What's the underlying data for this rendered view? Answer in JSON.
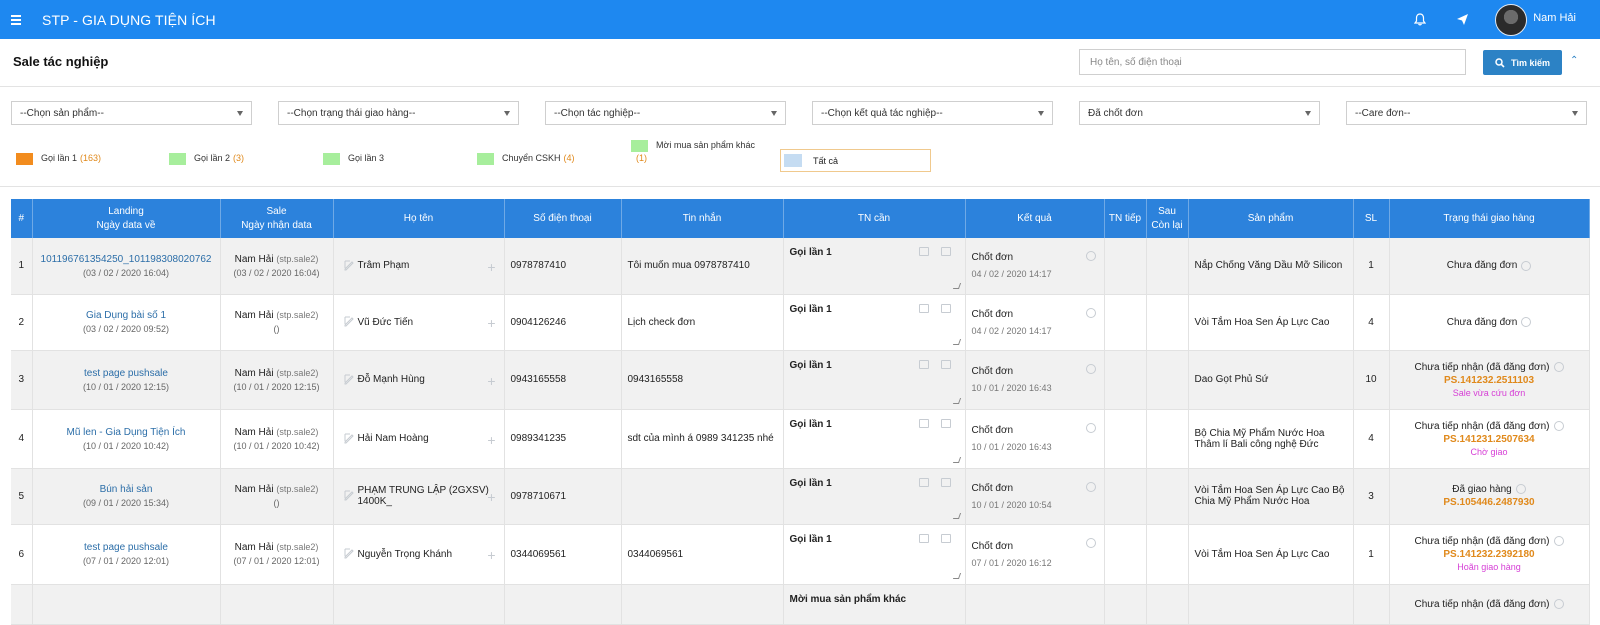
{
  "app": {
    "title": "STP - GIA DỤNG TIỆN ÍCH",
    "user": "Nam Hải"
  },
  "header": {
    "title": "Sale tác nghiệp",
    "search_placeholder": "Họ tên, số điện thoại",
    "search_label": "Tìm kiếm"
  },
  "filters": [
    "--Chọn sản phẩm--",
    "--Chọn trạng thái giao hàng--",
    "--Chọn tác nghiệp--",
    "--Chọn kết quả tác nghiệp--",
    "Đã chốt đơn",
    "--Care đơn--"
  ],
  "legend": [
    {
      "label": "Gọi lần 1",
      "count": "(163)",
      "color": "#f28c1e"
    },
    {
      "label": "Gọi lần 2",
      "count": "(3)",
      "color": "#a7ee9c"
    },
    {
      "label": "Gọi lần 3",
      "count": "",
      "color": "#a7ee9c"
    },
    {
      "label": "Chuyển CSKH",
      "count": "(4)",
      "color": "#a7ee9c"
    },
    {
      "label": "Mời mua sản phẩm khác",
      "count": "(1)",
      "color": "#a7ee9c"
    }
  ],
  "legend_all": {
    "label": "Tất cả",
    "color": "#c5dcf2"
  },
  "table": {
    "headers": {
      "num": "#",
      "landing_1": "Landing",
      "landing_2": "Ngày data về",
      "sale_1": "Sale",
      "sale_2": "Ngày nhận data",
      "name": "Họ tên",
      "phone": "Số điện thoại",
      "message": "Tin nhắn",
      "tncan": "TN cần",
      "result": "Kết quả",
      "tntiep": "TN tiếp",
      "sau_1": "Sau",
      "sau_2": "Còn lại",
      "product": "Sản phẩm",
      "qty": "SL",
      "status": "Trạng thái giao hàng"
    },
    "rows": [
      {
        "num": "1",
        "landing": "101196761354250_101198308020762",
        "landing_date": "(03 / 02 / 2020 16:04)",
        "sale": "Nam Hải",
        "sale_code": "(stp.sale2)",
        "sale_date": "(03 / 02 / 2020 16:04)",
        "name": "Trâm Phạm",
        "phone": "0978787410",
        "message": "Tôi muốn mua 0978787410",
        "tncan": "Gọi lần 1",
        "result": "Chốt đơn",
        "result_date": "04 / 02 / 2020 14:17",
        "product": "Nắp Chống Văng Dầu Mỡ Silicon",
        "qty": "1",
        "status": "Chưa đăng đơn",
        "status_code": "",
        "status_note": ""
      },
      {
        "num": "2",
        "landing": "Gia Dụng bài số 1",
        "landing_date": "(03 / 02 / 2020 09:52)",
        "sale": "Nam Hải",
        "sale_code": "(stp.sale2)",
        "sale_date": "()",
        "name": "Vũ Đức Tiến",
        "phone": "0904126246",
        "message": "Lịch check đơn",
        "tncan": "Gọi lần 1",
        "result": "Chốt đơn",
        "result_date": "04 / 02 / 2020 14:17",
        "product": "Vòi Tắm Hoa Sen Áp Lực Cao",
        "qty": "4",
        "status": "Chưa đăng đơn",
        "status_code": "",
        "status_note": ""
      },
      {
        "num": "3",
        "landing": "test page pushsale",
        "landing_date": "(10 / 01 / 2020 12:15)",
        "sale": "Nam Hải",
        "sale_code": "(stp.sale2)",
        "sale_date": "(10 / 01 / 2020 12:15)",
        "name": "Đỗ Mạnh Hùng",
        "phone": "0943165558",
        "message": "0943165558",
        "tncan": "Gọi lần 1",
        "result": "Chốt đơn",
        "result_date": "10 / 01 / 2020 16:43",
        "product": "Dao Gọt Phủ Sứ",
        "qty": "10",
        "status": "Chưa tiếp nhận (đã đăng đơn)",
        "status_code": "PS.141232.2511103",
        "status_note": "Sale vừa cứu đơn"
      },
      {
        "num": "4",
        "landing": "Mũ len - Gia Dụng Tiện Ích",
        "landing_date": "(10 / 01 / 2020 10:42)",
        "sale": "Nam Hải",
        "sale_code": "(stp.sale2)",
        "sale_date": "(10 / 01 / 2020 10:42)",
        "name": "Hải Nam Hoàng",
        "phone": "0989341235",
        "message": "sdt của mình á 0989 341235 nhé",
        "tncan": "Gọi lần 1",
        "result": "Chốt đơn",
        "result_date": "10 / 01 / 2020 16:43",
        "product": "Bộ Chia Mỹ Phẩm Nước Hoa Thâm lí Bali công nghệ Đức",
        "qty": "4",
        "status": "Chưa tiếp nhận (đã đăng đơn)",
        "status_code": "PS.141231.2507634",
        "status_note": "Chờ giao"
      },
      {
        "num": "5",
        "landing": "Bún hải sản",
        "landing_date": "(09 / 01 / 2020 15:34)",
        "sale": "Nam Hải",
        "sale_code": "(stp.sale2)",
        "sale_date": "()",
        "name": "PHẠM TRUNG LẬP (2GXSV) 1400K_",
        "phone": "0978710671",
        "message": "",
        "tncan": "Gọi lần 1",
        "result": "Chốt đơn",
        "result_date": "10 / 01 / 2020 10:54",
        "product": "Vòi Tắm Hoa Sen Áp Lực Cao Bộ Chia Mỹ Phẩm Nước Hoa",
        "qty": "3",
        "status": "Đã giao hàng",
        "status_code": "PS.105446.2487930",
        "status_note": ""
      },
      {
        "num": "6",
        "landing": "test page pushsale",
        "landing_date": "(07 / 01 / 2020 12:01)",
        "sale": "Nam Hải",
        "sale_code": "(stp.sale2)",
        "sale_date": "(07 / 01 / 2020 12:01)",
        "name": "Nguyễn Trọng Khánh",
        "phone": "0344069561",
        "message": "0344069561",
        "tncan": "Gọi lần 1",
        "result": "Chốt đơn",
        "result_date": "07 / 01 / 2020 16:12",
        "product": "Vòi Tắm Hoa Sen Áp Lực Cao",
        "qty": "1",
        "status": "Chưa tiếp nhận (đã đăng đơn)",
        "status_code": "PS.141232.2392180",
        "status_note": "Hoãn giao hàng"
      },
      {
        "num": "",
        "landing": "",
        "landing_date": "",
        "sale": "",
        "sale_code": "",
        "sale_date": "",
        "name": "",
        "phone": "",
        "message": "",
        "tncan": "Mời mua sản phẩm khác",
        "result": "",
        "result_date": "",
        "product": "",
        "qty": "",
        "status": "Chưa tiếp nhận (đã đăng đơn)",
        "status_code": "",
        "status_note": ""
      }
    ]
  }
}
